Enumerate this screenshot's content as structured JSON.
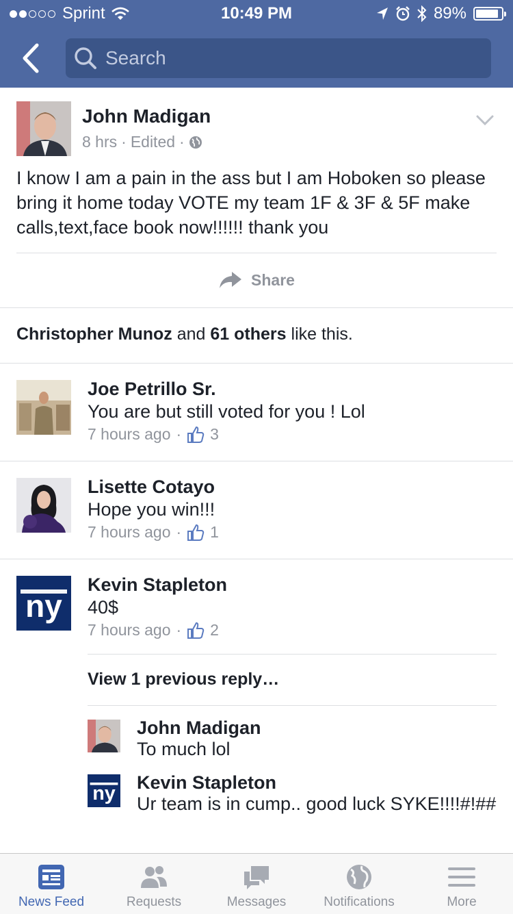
{
  "status_bar": {
    "carrier": "Sprint",
    "time": "10:49 PM",
    "battery": "89%",
    "battery_level": 0.89,
    "signal_bars_filled": 2,
    "signal_bars_total": 5
  },
  "nav": {
    "search_placeholder": "Search",
    "accent": "#4e69a2"
  },
  "post": {
    "author": "John Madigan",
    "time": "8 hrs",
    "edited": "Edited",
    "separator": "·",
    "text": "I know I am a pain in the ass but I am Hoboken so please bring it home today VOTE my team 1F & 3F & 5F make calls,text,face book now!!!!!! thank you",
    "share_label": "Share",
    "likes": {
      "first_name": "Christopher Munoz",
      "and": "and",
      "count": "61",
      "others": "others",
      "suffix": "like this."
    }
  },
  "comments": [
    {
      "name": "Joe Petrillo Sr.",
      "text": "You are but still voted for you ! Lol",
      "time": "7 hours ago",
      "likes": "3"
    },
    {
      "name": "Lisette Cotayo",
      "text": "Hope you win!!!",
      "time": "7 hours ago",
      "likes": "1"
    },
    {
      "name": "Kevin Stapleton",
      "text": "40$",
      "time": "7 hours ago",
      "likes": "2"
    }
  ],
  "view_previous": "View 1 previous reply…",
  "replies": [
    {
      "name": "John Madigan",
      "text": "To much lol"
    },
    {
      "name": "Kevin Stapleton",
      "text": "Ur team is in cump.. good luck SYKE!!!!#!##"
    }
  ],
  "logo_text": "ny",
  "tabs": [
    {
      "label": "News Feed",
      "icon": "news-feed-icon",
      "active": true
    },
    {
      "label": "Requests",
      "icon": "friends-icon",
      "active": false
    },
    {
      "label": "Messages",
      "icon": "messages-icon",
      "active": false
    },
    {
      "label": "Notifications",
      "icon": "globe-icon",
      "active": false
    },
    {
      "label": "More",
      "icon": "menu-icon",
      "active": false
    }
  ]
}
